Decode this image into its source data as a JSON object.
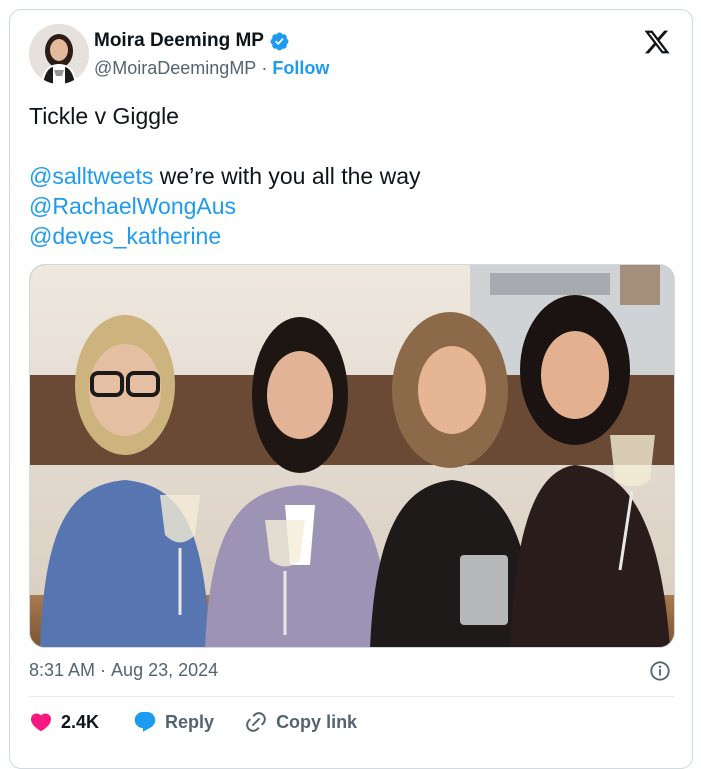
{
  "author": {
    "name": "Moira Deeming MP",
    "handle": "@MoiraDeemingMP",
    "separator": "·",
    "follow_label": "Follow",
    "verified": true
  },
  "tweet": {
    "line1": "Tickle v Giggle",
    "mention1": "@salltweets",
    "line3_rest": " we’re with you all the way",
    "mention2": "@RachaelWongAus",
    "mention3": "@deves_katherine"
  },
  "meta": {
    "time": "8:31 AM",
    "separator": "·",
    "date": "Aug 23, 2024"
  },
  "actions": {
    "like_count": "2.4K",
    "reply_label": "Reply",
    "copy_label": "Copy link"
  },
  "colors": {
    "accent": "#1d9bf0",
    "like": "#f91880",
    "muted": "#536471",
    "text": "#0f1419"
  },
  "icons": [
    "verified-badge-icon",
    "x-logo-icon",
    "info-icon",
    "heart-icon",
    "reply-bubble-icon",
    "link-icon"
  ]
}
